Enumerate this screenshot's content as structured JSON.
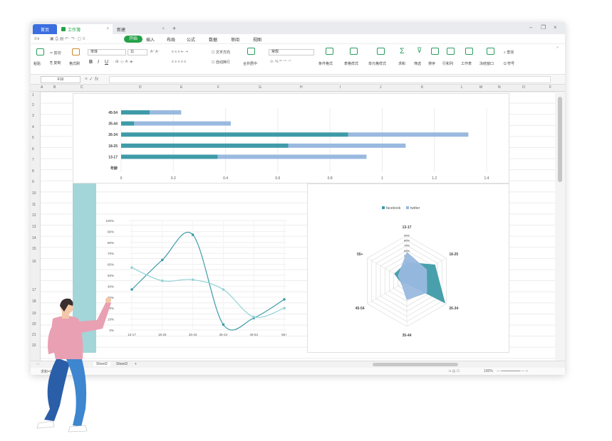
{
  "tabs": {
    "home": "首页",
    "workbook": "工作簿",
    "newtab": "新建"
  },
  "menu": {
    "items": [
      "开始",
      "插入",
      "布局",
      "公式",
      "数据",
      "审阅",
      "视图"
    ]
  },
  "ribbon": {
    "paste": "粘贴",
    "cut": "剪切",
    "copy": "复制",
    "format_painter": "格式刷",
    "font": "宋体",
    "size": "11",
    "wrap_label": "文字方向",
    "auto_wrap": "自动换行",
    "merge": "合并居中",
    "number_format": "常规",
    "cond_format": "条件格式",
    "table_style": "表格样式",
    "cell_style": "单元格样式",
    "sum": "求和",
    "filter": "筛选",
    "sort": "排序",
    "row_col": "行和列",
    "worksheet": "工作表",
    "freeze": "冻结窗口",
    "find": "查找",
    "symbol": "符号"
  },
  "formula": {
    "cell": "F10",
    "fx": "fx"
  },
  "columns": [
    "A",
    "B",
    "C",
    "D",
    "E",
    "F",
    "G",
    "H",
    "I",
    "J",
    "K",
    "L",
    "M",
    "N",
    "O",
    "F"
  ],
  "rows": [
    "1",
    "2",
    "3",
    "4",
    "5",
    "6",
    "7",
    "8",
    "9",
    "10",
    "11",
    "12",
    "13",
    "14",
    "15",
    "16",
    "17",
    "18",
    "19",
    "20",
    "21",
    "22"
  ],
  "sheets": [
    "Sheet2",
    "Sheet3"
  ],
  "status": {
    "left": "求和=0",
    "zoom": "100%"
  },
  "colors": {
    "teal": "#3f9ba8",
    "light_blue": "#99b9df",
    "pale_teal": "#93d1d6",
    "accent_green": "#24a148",
    "home_blue": "#3b6ee0"
  },
  "chart_data": [
    {
      "type": "bar",
      "orientation": "horizontal",
      "stacked": true,
      "categories": [
        "年龄",
        "13-17",
        "18-25",
        "26-34",
        "35-44",
        "45-54"
      ],
      "series": [
        {
          "values": [
            0,
            0.37,
            0.64,
            0.87,
            0.05,
            0.11
          ]
        },
        {
          "values": [
            0,
            0.57,
            0.45,
            0.46,
            0.37,
            0.12
          ]
        }
      ],
      "xticks": [
        "0",
        "0.2",
        "0.4",
        "0.6",
        "0.8",
        "1",
        "1.2",
        "1.4"
      ],
      "xlim": [
        0,
        1.4
      ]
    },
    {
      "type": "line",
      "categories": [
        "13-17",
        "18-25",
        "26-34",
        "35-44",
        "45-54",
        "55+"
      ],
      "series": [
        {
          "values": [
            0.37,
            0.64,
            0.87,
            0.05,
            0.11,
            0.28
          ]
        },
        {
          "values": [
            0.57,
            0.45,
            0.46,
            0.37,
            0.12,
            0.2
          ]
        }
      ],
      "yticks": [
        "0%",
        "10%",
        "20%",
        "30%",
        "40%",
        "50%",
        "60%",
        "70%",
        "80%",
        "90%",
        "100%"
      ],
      "ylim": [
        0,
        1
      ]
    },
    {
      "type": "radar",
      "categories": [
        "13-17",
        "18-25",
        "26-34",
        "35-44",
        "45-54",
        "55+"
      ],
      "series": [
        {
          "name": "facebook",
          "values": [
            0.37,
            0.64,
            0.87,
            0.05,
            0.11,
            0.28
          ]
        },
        {
          "name": "twitter",
          "values": [
            0.57,
            0.45,
            0.46,
            0.37,
            0.12,
            0.2
          ]
        }
      ],
      "rticks": [
        "0%",
        "10%",
        "20%",
        "30%",
        "40%",
        "50%",
        "60%",
        "70%",
        "80%",
        "90%"
      ],
      "legend": "top"
    }
  ]
}
